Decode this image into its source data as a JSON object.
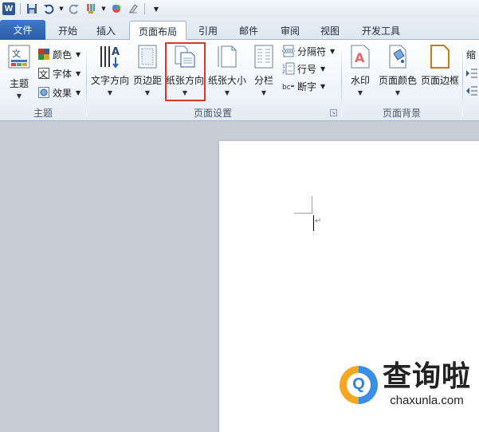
{
  "qat": {
    "icons": [
      "word-logo",
      "save-icon",
      "undo-icon",
      "redo-icon",
      "format-painter-icon",
      "color-icon",
      "clear-format-icon",
      "customize-icon"
    ],
    "word_logo_text": "W"
  },
  "tabs": [
    {
      "label": "文件",
      "active": false
    },
    {
      "label": "开始",
      "active": false
    },
    {
      "label": "插入",
      "active": false
    },
    {
      "label": "页面布局",
      "active": true
    },
    {
      "label": "引用",
      "active": false
    },
    {
      "label": "邮件",
      "active": false
    },
    {
      "label": "审阅",
      "active": false
    },
    {
      "label": "视图",
      "active": false
    },
    {
      "label": "开发工具",
      "active": false
    }
  ],
  "ribbon": {
    "theme_group": {
      "label": "主题",
      "themes_button": "主题",
      "colors": "颜色",
      "fonts": "字体",
      "effects": "效果"
    },
    "page_setup_group": {
      "label": "页面设置",
      "text_direction": "文字方向",
      "margins": "页边距",
      "orientation": "纸张方向",
      "size": "纸张大小",
      "columns": "分栏",
      "breaks": "分隔符",
      "line_numbers": "行号",
      "hyphenation": "断字"
    },
    "page_background_group": {
      "label": "页面背景",
      "watermark": "水印",
      "page_color": "页面颜色",
      "page_borders": "页面边框"
    },
    "partial_next": "缩"
  },
  "watermark": {
    "site_name": "查询啦",
    "site_url": "chaxunla.com",
    "logo_letter": "Q"
  },
  "colors": {
    "file_tab": "#2a5ca8",
    "highlight": "#d9372e",
    "doc_background": "#c9ced6"
  }
}
